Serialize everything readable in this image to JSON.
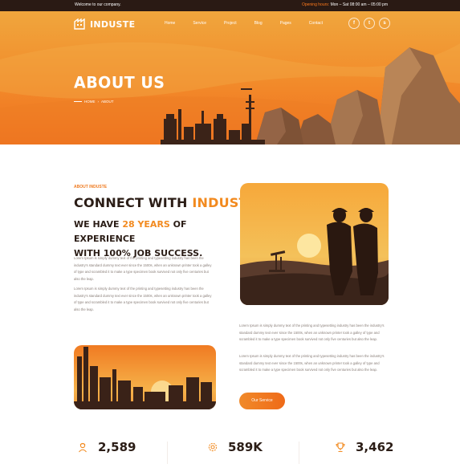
{
  "topbar": {
    "welcome": "Welcome to our company.",
    "hours_label": "Opening hours:",
    "hours_value": "Mon – Sat  08:00 am – 05:00 pm"
  },
  "brand": {
    "name": "INDUSTE"
  },
  "nav": [
    "Home",
    "Service",
    "Project",
    "Blog",
    "Pages",
    "Contact"
  ],
  "social": [
    {
      "icon": "facebook-icon",
      "glyph": "f"
    },
    {
      "icon": "twitter-icon",
      "glyph": "t"
    },
    {
      "icon": "skype-icon",
      "glyph": "s"
    }
  ],
  "hero": {
    "title": "ABOUT US",
    "breadcrumb_home": "HOME",
    "breadcrumb_sep": "›",
    "breadcrumb_current": "ABOUT"
  },
  "about": {
    "tag": "ABOUT INDUSTE",
    "heading_prefix": "CONNECT WITH ",
    "heading_accent": "INDUSTE.",
    "sub_prefix": "WE HAVE ",
    "sub_accent": "28 YEARS",
    "sub_suffix": " OF EXPERIENCE",
    "sub_line2": "WITH 100% JOB SUCCESS.",
    "para1": "Lorem Ipsum is simply dummy text of the printing and typesetting industry has been the industry's standard dummy text ever since the 1500s, when an unknown printer took a galley of type and scrambled it to make a type specimen book survived not only five centuries but also the leap.",
    "para2": "Lorem Ipsum is simply dummy text of the printing and typesetting industry has been the industry's standard dummy text ever since the 1500s, when an unknown printer took a galley of type and scrambled it to make a type specimen book survived not only five centuries but also the leap.",
    "para3": "Lorem Ipsum is simply dummy text of the printing and typesetting industry has been the industry's standard dummy text ever since the 1500s, when an unknown printer took a galley of type and scrambled it to make a type specimen book survived not only five centuries but also the leap.",
    "para4": "Lorem Ipsum is simply dummy text of the printing and typesetting industry has been the industry's standard dummy text ever since the 1500s, when an unknown printer took a galley of type and scrambled it to make a type specimen book survived not only five centuries but also the leap.",
    "button": "Our Service"
  },
  "stats": [
    {
      "icon": "worker-icon",
      "value": "2,589"
    },
    {
      "icon": "gear-icon",
      "value": "589K"
    },
    {
      "icon": "trophy-icon",
      "value": "3,462"
    }
  ],
  "colors": {
    "accent": "#f28a1f",
    "dark": "#2a1a14",
    "hero_top": "#f0a63d",
    "hero_bottom": "#ef6e1e"
  }
}
